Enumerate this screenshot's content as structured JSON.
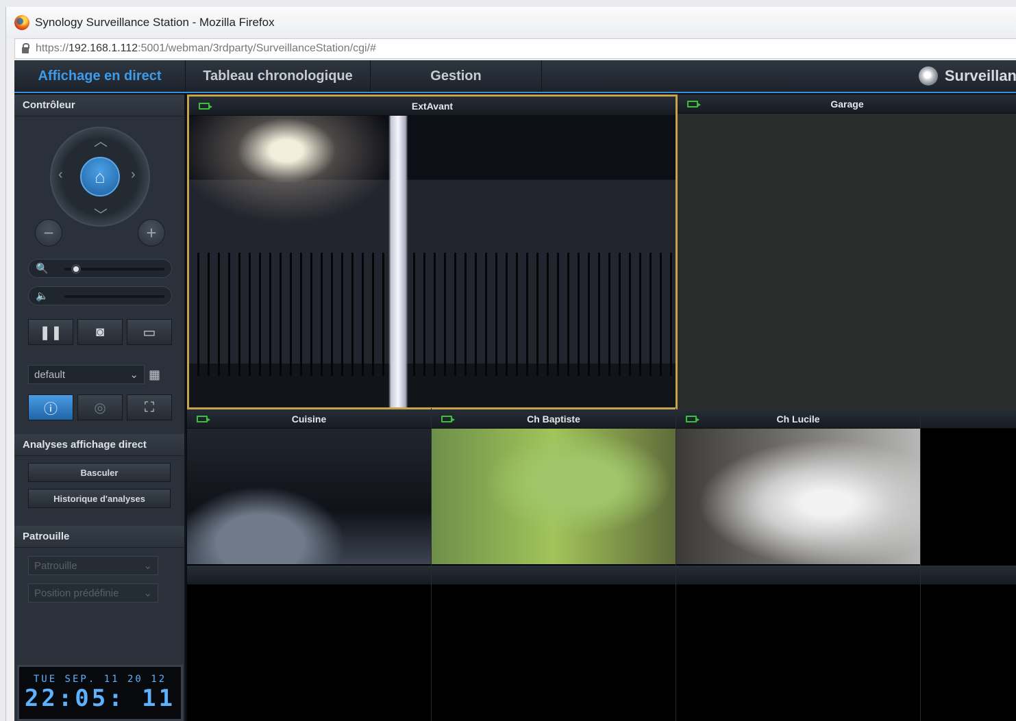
{
  "window": {
    "title": "Synology Surveillance Station - Mozilla Firefox",
    "url_prefix": "https://",
    "url_host": "192.168.1.112",
    "url_rest": ":5001/webman/3rdparty/SurveillanceStation/cgi/#"
  },
  "nav": {
    "tabs": [
      "Affichage en direct",
      "Tableau chronologique",
      "Gestion"
    ],
    "brand": "Surveillan"
  },
  "sidebar": {
    "controller_title": "Contrôleur",
    "layout_select": "default",
    "analytics_title": "Analyses affichage direct",
    "analytics_buttons": [
      "Basculer",
      "Historique d'analyses"
    ],
    "patrol_title": "Patrouille",
    "patrol_select": "Patrouille",
    "preset_select": "Position prédéfinie",
    "clock_date": "TUE SEP. 11 20 12",
    "clock_time": "22:05: 11"
  },
  "cameras": [
    {
      "name": "ExtAvant",
      "status_color": "#3dbf3d"
    },
    {
      "name": "Garage",
      "status_color": "#3dbf3d"
    },
    {
      "name": "Cuisine",
      "status_color": "#3dbf3d"
    },
    {
      "name": "Ch Baptiste",
      "status_color": "#3dbf3d"
    },
    {
      "name": "Ch Lucile",
      "status_color": "#3dbf3d"
    }
  ],
  "colors": {
    "accent": "#3d9be9",
    "selected_border": "#c8a44a"
  }
}
